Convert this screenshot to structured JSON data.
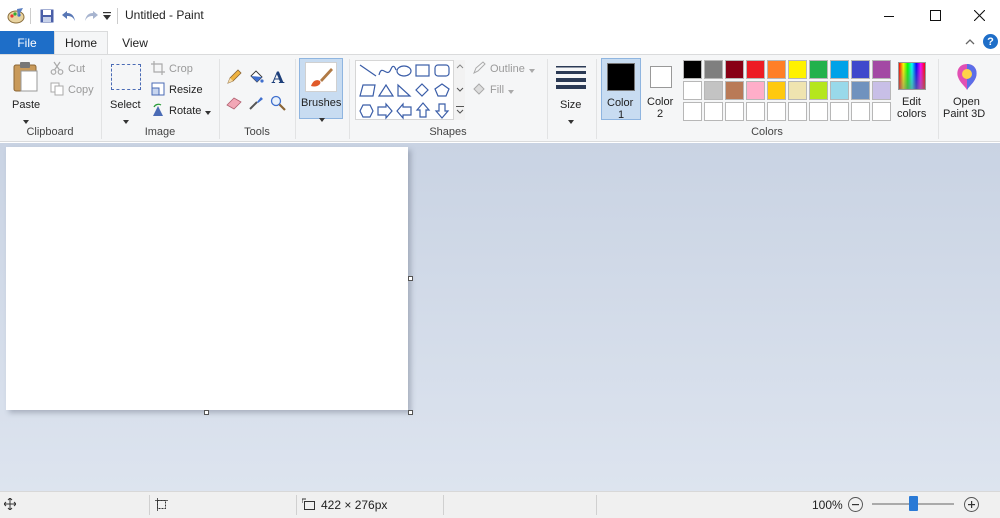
{
  "window": {
    "title": "Untitled - Paint"
  },
  "tabs": [
    {
      "label": "File"
    },
    {
      "label": "Home"
    },
    {
      "label": "View"
    }
  ],
  "clipboard": {
    "paste": "Paste",
    "cut": "Cut",
    "copy": "Copy",
    "group": "Clipboard"
  },
  "image": {
    "select": "Select",
    "crop": "Crop",
    "resize": "Resize",
    "rotate": "Rotate",
    "group": "Image"
  },
  "tools": {
    "group": "Tools"
  },
  "brushes": {
    "label": "Brushes"
  },
  "shapes": {
    "outline": "Outline",
    "fill": "Fill",
    "group": "Shapes"
  },
  "size": {
    "label": "Size"
  },
  "colors": {
    "color1_label": "Color",
    "color1_num": "1",
    "color2_label": "Color",
    "color2_num": "2",
    "color1_value": "#000000",
    "color2_value": "#ffffff",
    "edit_line1": "Edit",
    "edit_line2": "colors",
    "group": "Colors",
    "palette_row1": [
      "#000000",
      "#7f7f7f",
      "#880015",
      "#ed1c24",
      "#ff7f27",
      "#fff200",
      "#22b14c",
      "#00a2e8",
      "#3f48cc",
      "#a349a4"
    ],
    "palette_row2": [
      "#ffffff",
      "#c3c3c3",
      "#b97a57",
      "#ffaec9",
      "#ffc90e",
      "#efe4b0",
      "#b5e61d",
      "#99d9ea",
      "#7092be",
      "#c8bfe7"
    ],
    "palette_row3": [
      "#ffffff",
      "#ffffff",
      "#ffffff",
      "#ffffff",
      "#ffffff",
      "#ffffff",
      "#ffffff",
      "#ffffff",
      "#ffffff",
      "#ffffff"
    ]
  },
  "paint3d": {
    "line1": "Open",
    "line2": "Paint 3D"
  },
  "status": {
    "dimensions": "422 × 276px",
    "zoom": "100%",
    "zoom_level": 1.0
  }
}
